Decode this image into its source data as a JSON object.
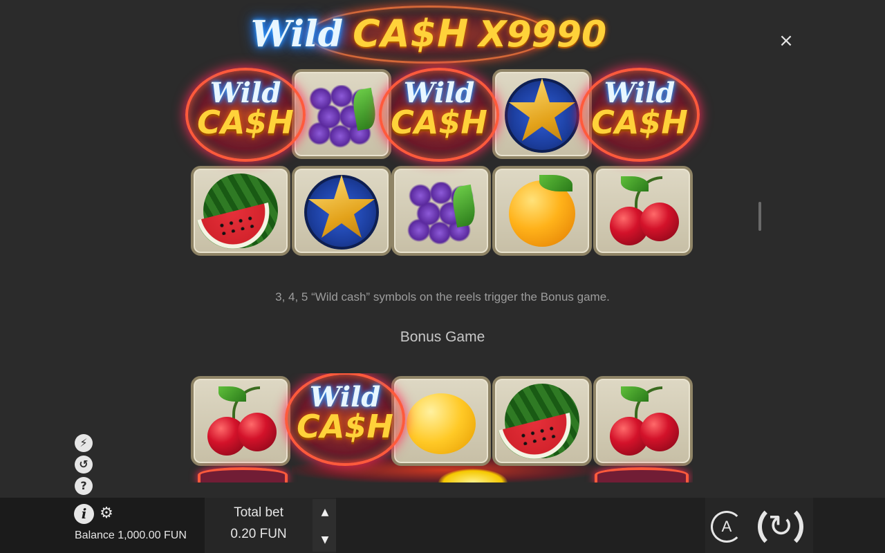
{
  "logo": {
    "wild": "Wild",
    "cash": "CA$H",
    "multiplier": "X9990"
  },
  "close_icon": "×",
  "reels_top": {
    "row1": [
      "wild-cash",
      "grapes",
      "wild-cash",
      "star",
      "wild-cash"
    ],
    "row2": [
      "watermelon",
      "star",
      "grapes",
      "orange",
      "cherry"
    ]
  },
  "reels_bonus": {
    "row1": [
      "cherry",
      "wild-cash",
      "lemon",
      "watermelon",
      "cherry"
    ]
  },
  "wild_symbol": {
    "top": "Wild",
    "bottom": "CA$H"
  },
  "description": "3, 4, 5 “Wild cash” symbols on the reels trigger the Bonus game.",
  "section_title": "Bonus Game",
  "side_icons": [
    "turbo-icon",
    "history-icon",
    "help-icon"
  ],
  "side_icon_glyphs": [
    "⚡",
    "↺",
    "?"
  ],
  "footer": {
    "info_glyph": "i",
    "gear_glyph": "⚙",
    "balance": "Balance 1,000.00 FUN",
    "total_bet_label": "Total bet",
    "total_bet_value": "0.20 FUN",
    "arrow_up": "▲",
    "arrow_down": "▼",
    "auto_label": "A"
  },
  "colors": {
    "background": "#2b2b2b",
    "footer": "#202020",
    "gold": "#ffd23a",
    "neon_blue": "#3aa7ff",
    "neon_red": "#ff2a5a"
  }
}
